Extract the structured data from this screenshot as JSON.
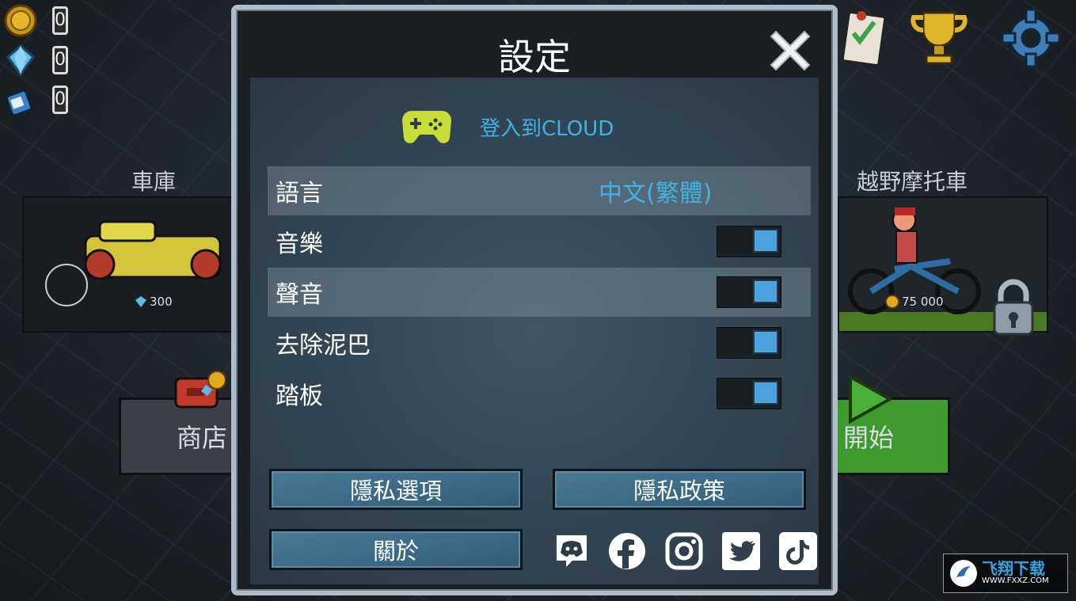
{
  "hud": {
    "coins": "0",
    "gems": "0",
    "fuel": "0"
  },
  "background": {
    "garage_label": "車庫",
    "garage_price": "300",
    "bike_label": "越野摩托車",
    "bike_price": "75 000",
    "shop_label": "商店",
    "start_label": "開始"
  },
  "settings": {
    "title": "設定",
    "cloud_label": "登入到CLOUD",
    "language_label": "語言",
    "language_value": "中文(繁體)",
    "music_label": "音樂",
    "sound_label": "聲音",
    "mud_label": "去除泥巴",
    "pedal_label": "踏板",
    "privacy_options_label": "隱私選項",
    "privacy_policy_label": "隱私政策",
    "about_label": "關於"
  },
  "toggles": {
    "music": true,
    "sound": true,
    "mud": true,
    "pedal": true
  },
  "colors": {
    "accent_blue": "#3fb3e6",
    "button_blue": "#3c6a86",
    "start_green": "#3f9a2e",
    "gamepad_yellow": "#c8dd3a"
  },
  "social_icons": [
    "discord-icon",
    "facebook-icon",
    "instagram-icon",
    "twitter-icon",
    "tiktok-icon"
  ],
  "watermark": {
    "text_top": "飞翔下载",
    "text_bottom": "WWW.FXXZ.COM"
  }
}
